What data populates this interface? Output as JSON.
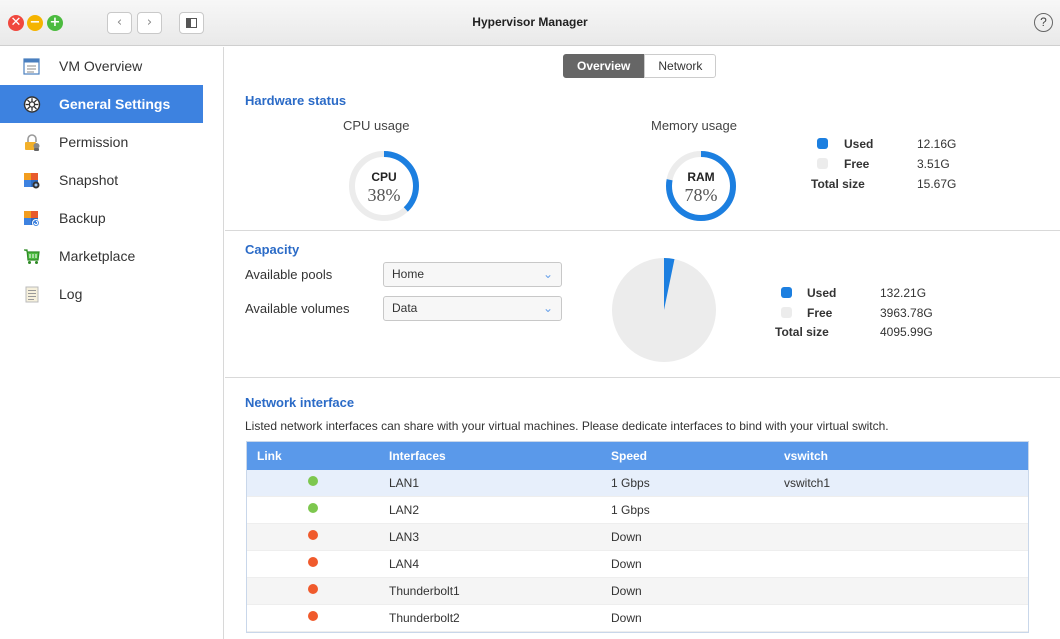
{
  "window": {
    "title": "Hypervisor Manager",
    "close_glyph": "✕",
    "min_glyph": "−",
    "max_glyph": "+",
    "back_glyph": "‹",
    "forward_glyph": "›",
    "help_glyph": "?"
  },
  "sidebar": {
    "items": [
      {
        "label": "VM Overview",
        "icon": "vm-overview-icon"
      },
      {
        "label": "General Settings",
        "icon": "settings-icon",
        "active": true
      },
      {
        "label": "Permission",
        "icon": "permission-icon"
      },
      {
        "label": "Snapshot",
        "icon": "snapshot-icon"
      },
      {
        "label": "Backup",
        "icon": "backup-icon"
      },
      {
        "label": "Marketplace",
        "icon": "cart-icon"
      },
      {
        "label": "Log",
        "icon": "log-icon"
      }
    ]
  },
  "tabs": {
    "overview": "Overview",
    "network": "Network"
  },
  "hardware": {
    "title": "Hardware status",
    "cpu": {
      "label": "CPU usage",
      "name": "CPU",
      "percent_text": "38%",
      "percent": 38
    },
    "memory": {
      "label": "Memory usage",
      "name": "RAM",
      "percent_text": "78%",
      "percent": 78,
      "used_label": "Used",
      "used_value": "12.16G",
      "free_label": "Free",
      "free_value": "3.51G",
      "total_label": "Total size",
      "total_value": "15.67G"
    }
  },
  "capacity": {
    "title": "Capacity",
    "pools_label": "Available pools",
    "pools_value": "Home",
    "volumes_label": "Available volumes",
    "volumes_value": "Data",
    "used_fraction": 0.0323,
    "used_label": "Used",
    "used_value": "132.21G",
    "free_label": "Free",
    "free_value": "3963.78G",
    "total_label": "Total size",
    "total_value": "4095.99G"
  },
  "network": {
    "title": "Network interface",
    "description": "Listed network interfaces can share with your virtual machines. Please dedicate interfaces to bind with your virtual switch.",
    "columns": {
      "link": "Link",
      "interfaces": "Interfaces",
      "speed": "Speed",
      "vswitch": "vswitch"
    },
    "rows": [
      {
        "status": "up",
        "interface": "LAN1",
        "speed": "1 Gbps",
        "vswitch": "vswitch1"
      },
      {
        "status": "up",
        "interface": "LAN2",
        "speed": "1 Gbps",
        "vswitch": ""
      },
      {
        "status": "down",
        "interface": "LAN3",
        "speed": "Down",
        "vswitch": ""
      },
      {
        "status": "down",
        "interface": "LAN4",
        "speed": "Down",
        "vswitch": ""
      },
      {
        "status": "down",
        "interface": "Thunderbolt1",
        "speed": "Down",
        "vswitch": ""
      },
      {
        "status": "down",
        "interface": "Thunderbolt2",
        "speed": "Down",
        "vswitch": ""
      }
    ]
  },
  "colors": {
    "accent": "#3d82e0",
    "gauge_blue": "#1c7fe0",
    "gauge_track": "#ececec",
    "status_up": "#7dc74e",
    "status_down": "#f05a2c",
    "section_title": "#2b6bc7"
  }
}
